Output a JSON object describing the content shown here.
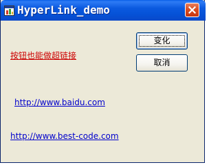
{
  "window": {
    "title": "HyperLink_demo"
  },
  "buttons": {
    "change_label": "变化",
    "cancel_label": "取消"
  },
  "links": {
    "button_link": "按钮也能做超链接",
    "baidu": "http://www.baidu.com",
    "best_code": "http://www.best-code.com"
  },
  "icons": {
    "app": "app-window-icon",
    "close": "close-icon"
  },
  "colors": {
    "titlebar": "#0552D7",
    "window_bg": "#ECE9D8",
    "close_button": "#DB4E22",
    "red_link": "#CC0000",
    "blue_link": "#0000CC"
  }
}
